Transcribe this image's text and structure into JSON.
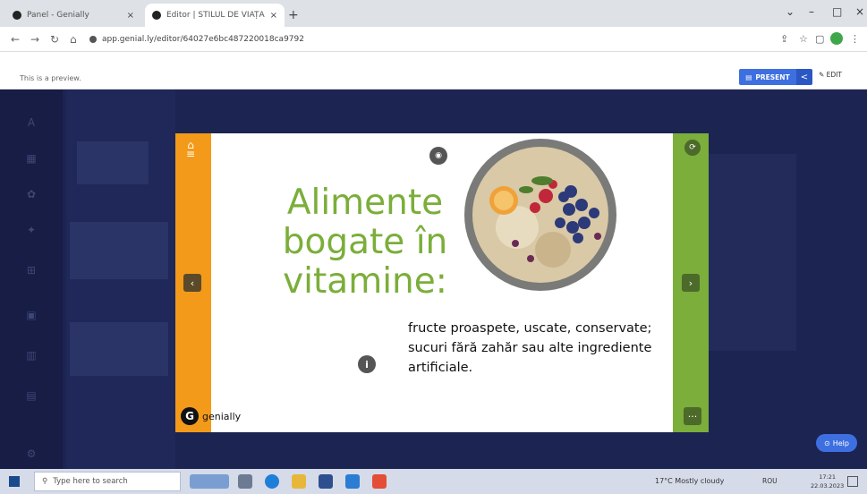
{
  "browser": {
    "tabs": [
      {
        "title": "Panel - Genially",
        "close": "×"
      },
      {
        "title": "Editor | STILUL DE VIAȚĂ SĂNĂT",
        "close": "×"
      }
    ],
    "new_tab": "+",
    "url": "app.genial.ly/editor/64027e6bc487220018ca9792",
    "window": {
      "minimize": "–",
      "maximize": "□",
      "close": "×"
    }
  },
  "preview": {
    "notice": "This is a preview.",
    "present_label": "PRESENT",
    "edit_label": "EDIT"
  },
  "slide": {
    "title": "Alimente bogate în vitamine:",
    "description": "fructe proaspete, uscate, conservate; sucuri fără zahăr sau alte ingrediente artificiale.",
    "brand": "genially",
    "brand_letter": "G",
    "colors": {
      "left_bar": "#f39a1a",
      "right_bar": "#7bae3a",
      "title": "#7bae3a"
    }
  },
  "help": {
    "label": "Help"
  },
  "taskbar": {
    "search_placeholder": "Type here to search",
    "weather": "17°C  Mostly cloudy",
    "lang": "ROU",
    "time": "17:21",
    "date": "22.03.2023"
  }
}
